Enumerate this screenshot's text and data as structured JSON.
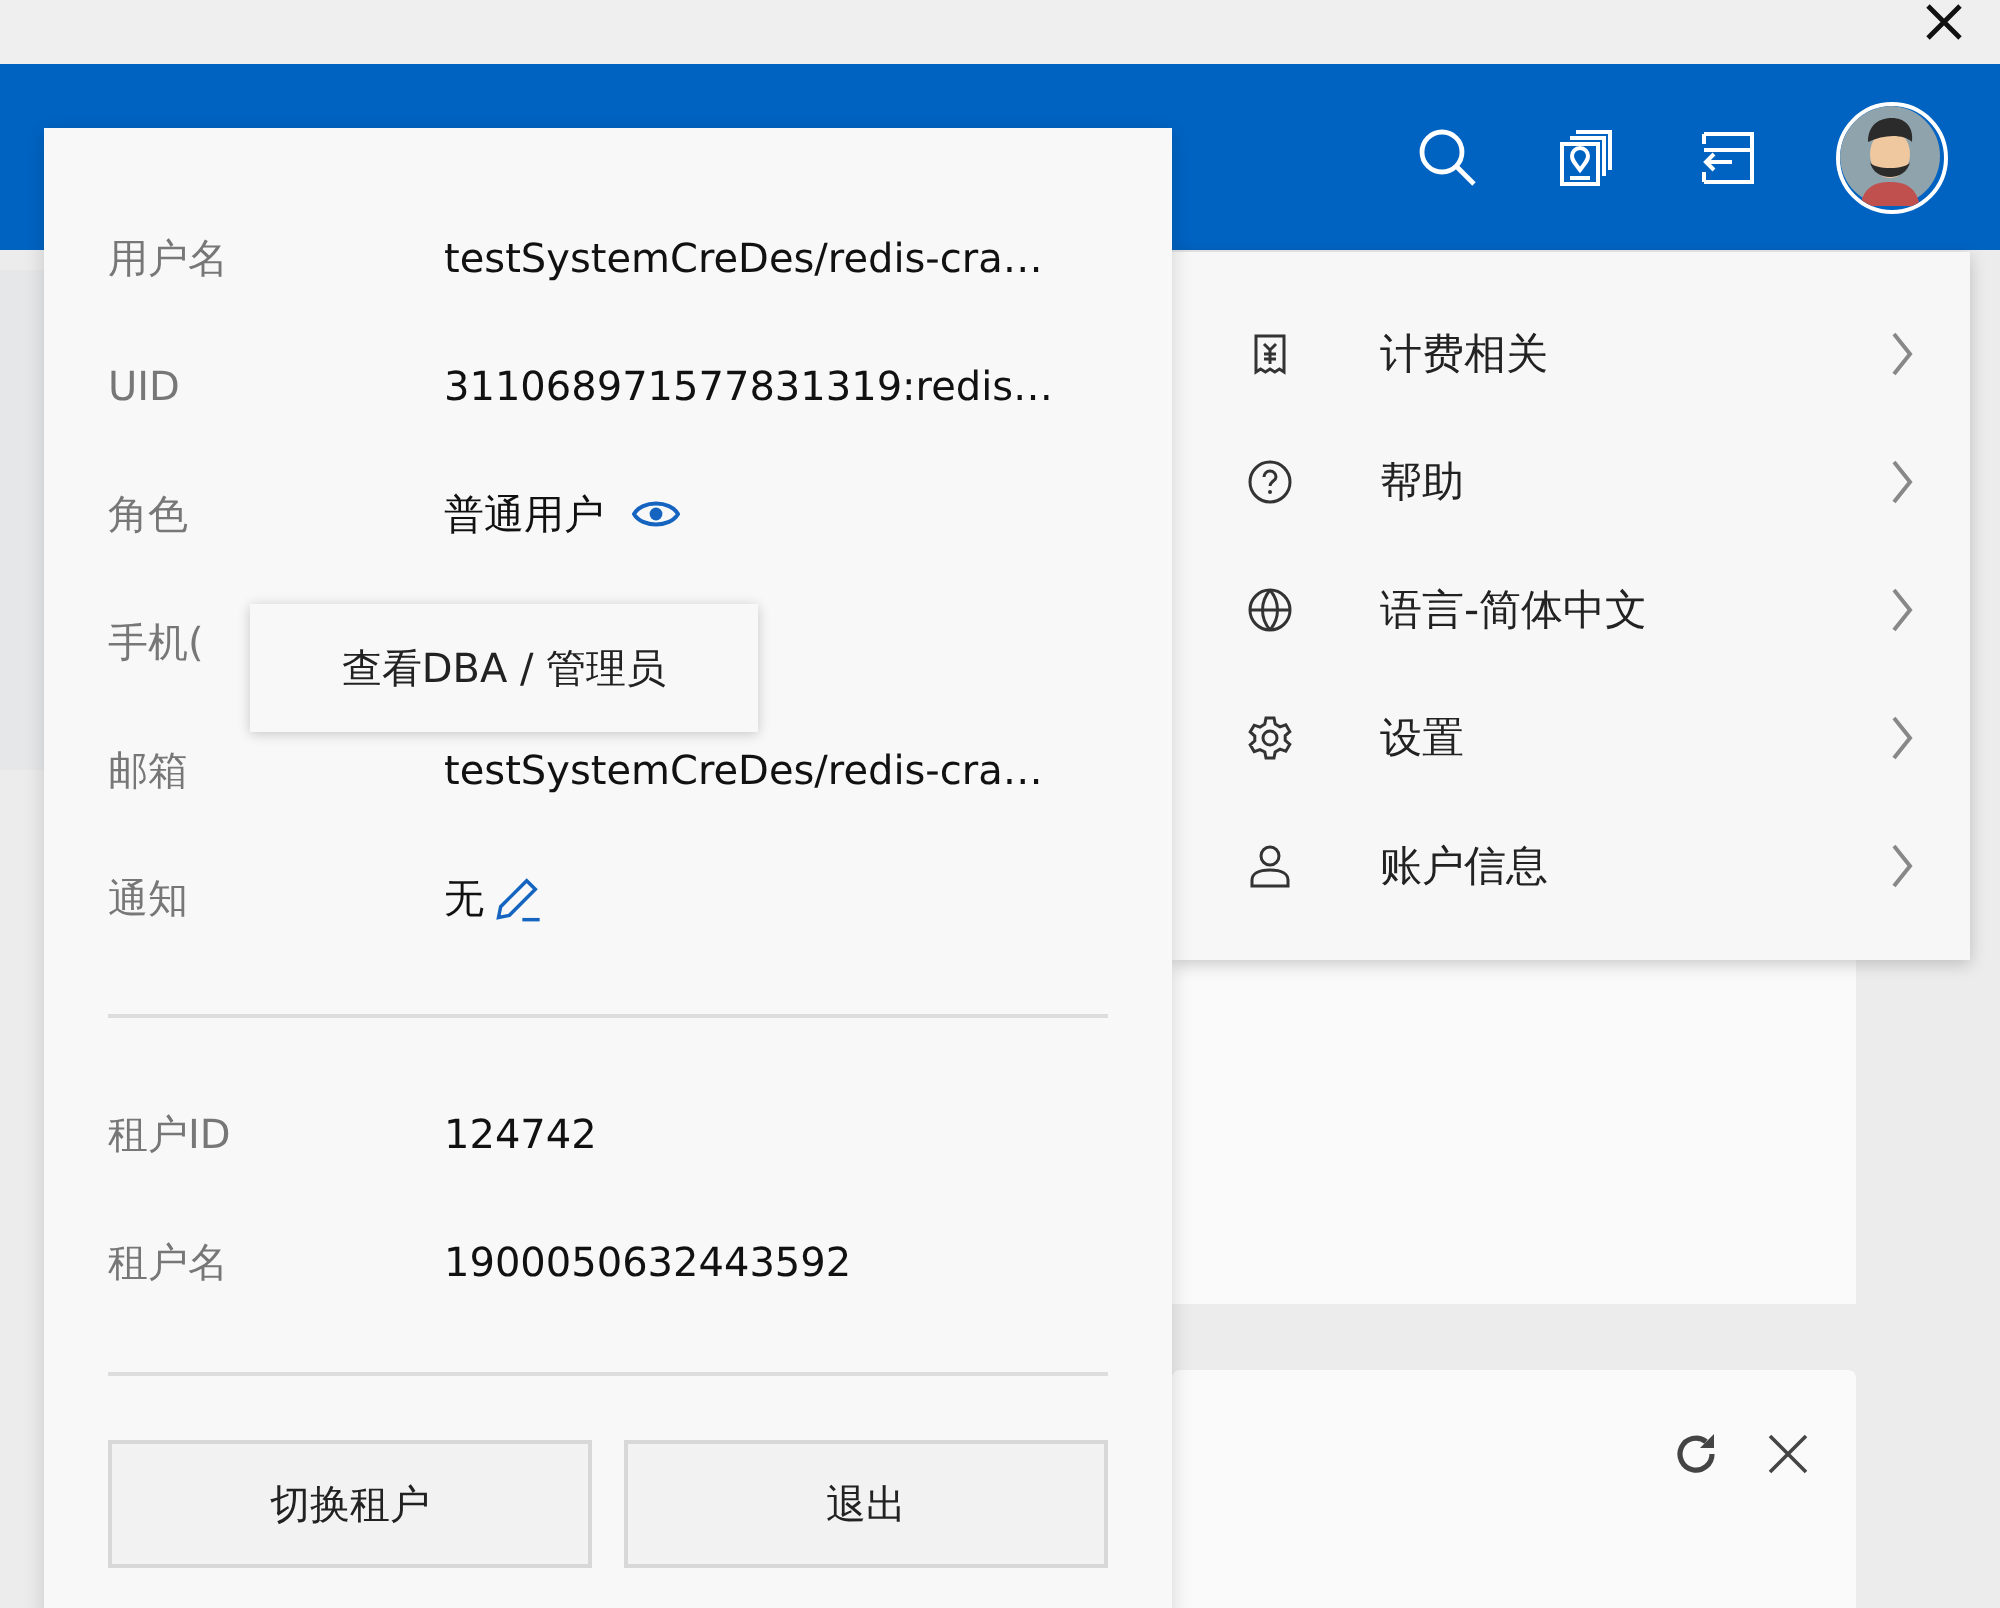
{
  "profile": {
    "fields": [
      {
        "label": "用户名",
        "value": "testSystemCreDes/redis-cra…",
        "kind": "text"
      },
      {
        "label": "UID",
        "value": "311068971577831319:redis…",
        "kind": "text"
      },
      {
        "label": "角色",
        "value": "普通用户",
        "kind": "role"
      },
      {
        "label": "手机(",
        "kind": "covered"
      },
      {
        "label": "邮箱",
        "value": "testSystemCreDes/redis-cra…",
        "kind": "text"
      },
      {
        "label": "通知",
        "value": "无",
        "kind": "editable"
      }
    ],
    "tenant_fields": [
      {
        "label": "租户ID",
        "value": "124742"
      },
      {
        "label": "租户名",
        "value": "1900050632443592"
      }
    ],
    "buttons": [
      "切换租户",
      "退出"
    ],
    "tooltip": "查看DBA / 管理员"
  },
  "menu": [
    {
      "label": "计费相关",
      "kind": "billing"
    },
    {
      "label": "帮助",
      "kind": "help"
    },
    {
      "label": "语言-简体中文",
      "kind": "language"
    },
    {
      "label": "设置",
      "kind": "settings"
    },
    {
      "label": "账户信息",
      "kind": "account"
    }
  ]
}
